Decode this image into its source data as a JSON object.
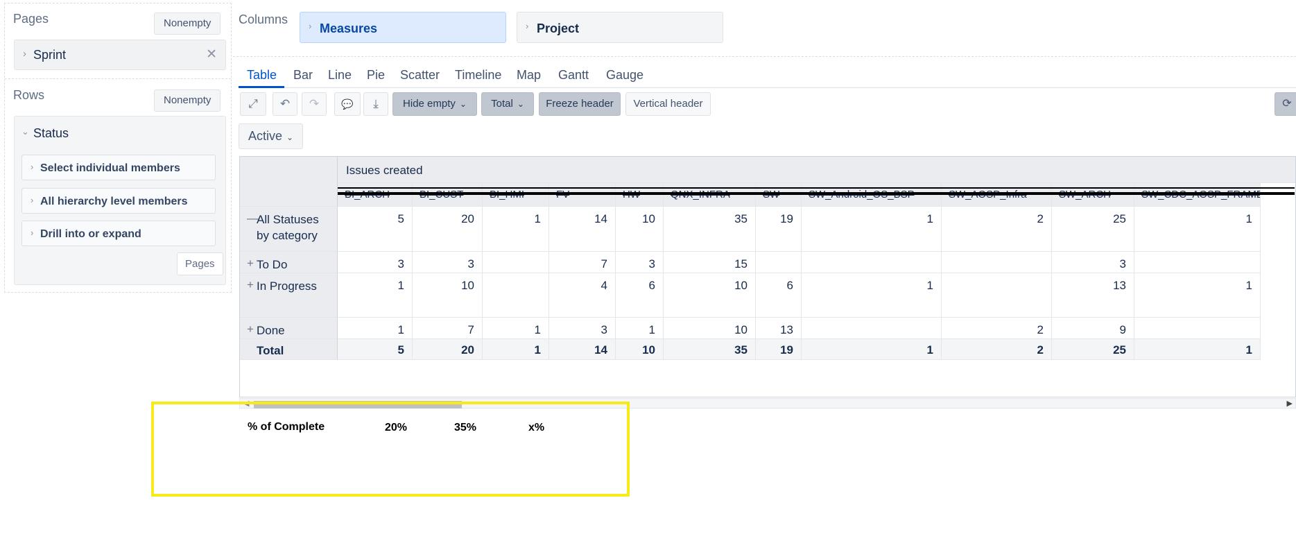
{
  "pages_panel": {
    "title": "Pages",
    "nonempty_label": "Nonempty",
    "chip_label": "Sprint"
  },
  "rows_panel": {
    "title": "Rows",
    "nonempty_label": "Nonempty",
    "status_label": "Status",
    "member_options": [
      "Select individual members",
      "All hierarchy level members",
      "Drill into or expand"
    ],
    "pages_button": "Pages"
  },
  "columns_panel": {
    "title": "Columns",
    "measures_label": "Measures",
    "project_label": "Project"
  },
  "tabs": [
    "Table",
    "Bar",
    "Line",
    "Pie",
    "Scatter",
    "Timeline",
    "Map",
    "Gantt",
    "Gauge"
  ],
  "active_tab": "Table",
  "toolbar": {
    "hide_empty": "Hide empty",
    "total": "Total",
    "freeze_header": "Freeze header",
    "vertical_header": "Vertical header"
  },
  "filter": {
    "active": "Active"
  },
  "table": {
    "measure_header": "Issues created",
    "project_headers": [
      "BI_ARCH",
      "BI_CUST",
      "BI_HMI",
      "FV",
      "HW",
      "QNX_INFRA",
      "SW",
      "SW_Android_OS_BSP",
      "SW_AOSP_Infra",
      "SW_ARCH",
      "SW_CDC_AOSP_FRAMEWORK"
    ],
    "rows": [
      {
        "label": "All Statuses by category",
        "expander": "—",
        "values": [
          "5",
          "20",
          "1",
          "14",
          "10",
          "35",
          "19",
          "1",
          "2",
          "25",
          "1"
        ]
      },
      {
        "label": "To Do",
        "expander": "+",
        "values": [
          "3",
          "3",
          "",
          "7",
          "3",
          "15",
          "",
          "",
          "",
          "3",
          ""
        ]
      },
      {
        "label": "In Progress",
        "expander": "+",
        "values": [
          "1",
          "10",
          "",
          "4",
          "6",
          "10",
          "6",
          "1",
          "",
          "13",
          "1"
        ]
      },
      {
        "label": "Done",
        "expander": "+",
        "values": [
          "1",
          "7",
          "1",
          "3",
          "1",
          "10",
          "13",
          "",
          "2",
          "9",
          ""
        ]
      }
    ],
    "total_row": {
      "label": "Total",
      "values": [
        "5",
        "20",
        "1",
        "14",
        "10",
        "35",
        "19",
        "1",
        "2",
        "25",
        "1"
      ]
    }
  },
  "annotation": {
    "label": "% of Complete",
    "values": [
      "20%",
      "35%",
      "x%"
    ],
    "highlight_color": "#f6ea18"
  },
  "icons": {
    "expand": "⤢",
    "undo": "↶",
    "redo": "↷",
    "comment": "💬",
    "download": "⤓",
    "refresh": "⟳",
    "chevron_right": "›",
    "chevron_down": "⌄",
    "close": "✕"
  }
}
